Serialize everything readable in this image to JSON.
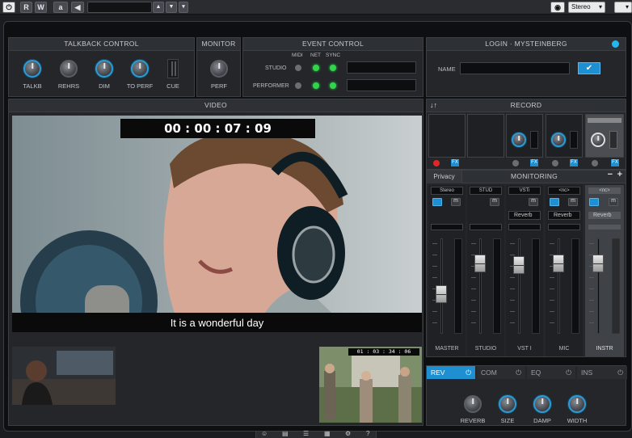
{
  "toolbar": {
    "buttons": [
      "R",
      "W",
      "a"
    ],
    "output_select": "Stereo"
  },
  "talkback": {
    "title": "TALKBACK CONTROL",
    "knobs": [
      "TALKB",
      "REHRS",
      "DIM",
      "TO PERF",
      "CUE"
    ]
  },
  "monitor": {
    "title": "MONITOR",
    "knob": "PERF"
  },
  "event_control": {
    "title": "EVENT CONTROL",
    "columns": [
      "MIDI",
      "NET",
      "SYNC"
    ],
    "rows": [
      "STUDIO",
      "PERFORMER"
    ]
  },
  "login": {
    "title": "LOGIN · MYSTEINBERG",
    "name_label": "NAME",
    "name_value": ""
  },
  "video": {
    "title": "VIDEO",
    "timecode": "00 : 00 : 07 : 09",
    "subtitle": "It is a wonderful day",
    "small_timecode": "01 : 03 : 34 : 06"
  },
  "record": {
    "title": "RECORD",
    "arrows": "↓↑"
  },
  "monitoring": {
    "title": "MONITORING",
    "privacy_label": "Privacy",
    "minus": "−",
    "plus": "+",
    "channels": [
      {
        "source": "Stereo",
        "insert": "",
        "name": "MASTER",
        "fader": 0.38
      },
      {
        "source": "STUD",
        "insert": "",
        "name": "STUDIO",
        "fader": 0.78
      },
      {
        "source": "VSTi",
        "insert": "Reverb",
        "name": "VST I",
        "fader": 0.7
      },
      {
        "source": "<nc>",
        "insert": "Reverb",
        "name": "MIC",
        "fader": 0.72
      },
      {
        "source": "<nc>",
        "insert": "Reverb",
        "name": "INSTR",
        "fader": 0.72
      }
    ]
  },
  "effects": {
    "tabs": [
      "REV",
      "COM",
      "EQ",
      "INS"
    ],
    "active_tab": "REV",
    "knobs": [
      "REVERB",
      "SIZE",
      "DAMP",
      "WIDTH"
    ]
  },
  "colors": {
    "accent": "#1e8fd0",
    "led_on": "#2fd64a",
    "record": "#e02626"
  }
}
